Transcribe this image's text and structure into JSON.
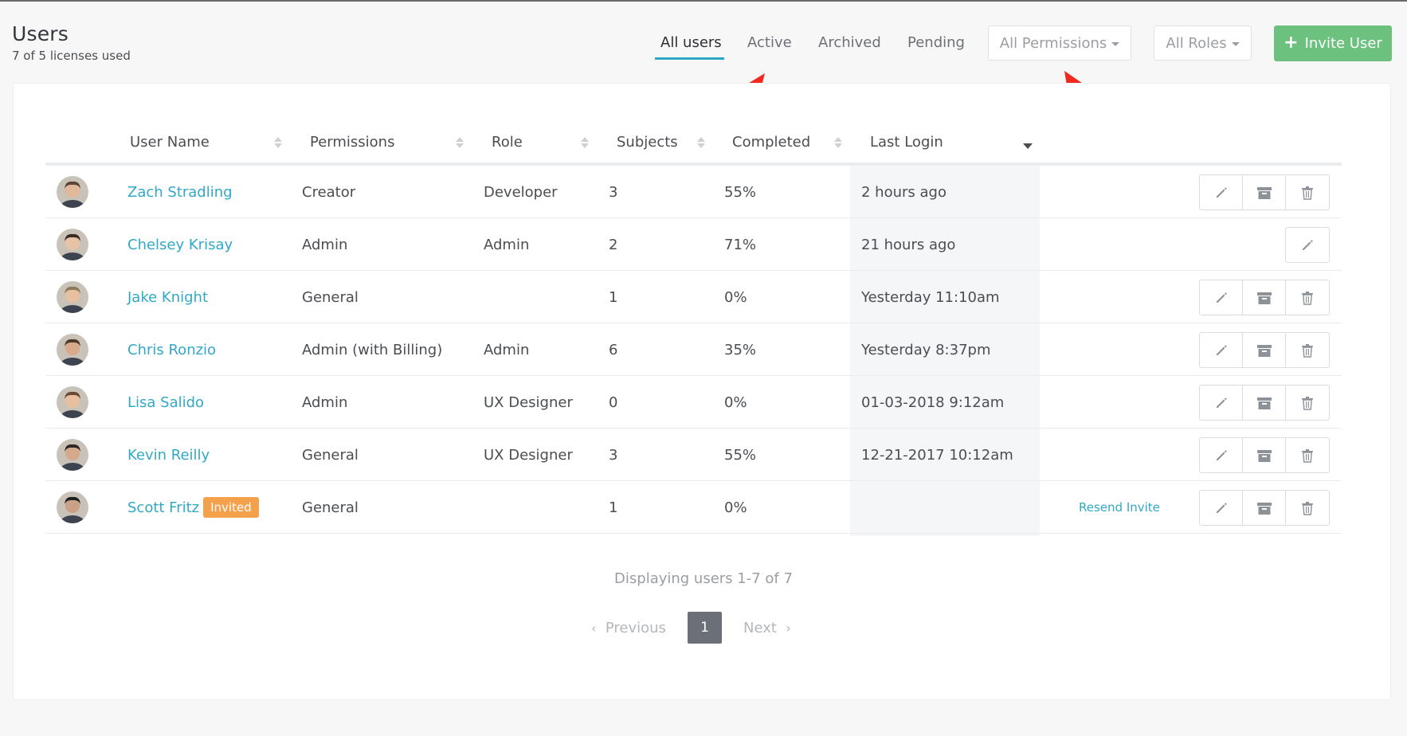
{
  "header": {
    "title": "Users",
    "license_text": "7 of 5 licenses used"
  },
  "tabs": [
    {
      "label": "All users",
      "active": true
    },
    {
      "label": "Active",
      "active": false
    },
    {
      "label": "Archived",
      "active": false
    },
    {
      "label": "Pending",
      "active": false
    }
  ],
  "filters": {
    "permissions": "All Permissions",
    "roles": "All Roles"
  },
  "invite_button": "Invite User",
  "table": {
    "columns": [
      "User Name",
      "Permissions",
      "Role",
      "Subjects",
      "Completed",
      "Last Login"
    ],
    "rows": [
      {
        "name": "Zach Stradling",
        "permissions": "Creator",
        "role": "Developer",
        "subjects": "3",
        "completed": "55%",
        "last_login": "2 hours ago",
        "badge": "",
        "resend": "",
        "actions": [
          "edit",
          "archive",
          "delete"
        ]
      },
      {
        "name": "Chelsey Krisay",
        "permissions": "Admin",
        "role": "Admin",
        "subjects": "2",
        "completed": "71%",
        "last_login": "21 hours ago",
        "badge": "",
        "resend": "",
        "actions": [
          "edit"
        ]
      },
      {
        "name": "Jake Knight",
        "permissions": "General",
        "role": "",
        "subjects": "1",
        "completed": "0%",
        "last_login": "Yesterday 11:10am",
        "badge": "",
        "resend": "",
        "actions": [
          "edit",
          "archive",
          "delete"
        ]
      },
      {
        "name": "Chris Ronzio",
        "permissions": "Admin (with Billing)",
        "role": "Admin",
        "subjects": "6",
        "completed": "35%",
        "last_login": "Yesterday 8:37pm",
        "badge": "",
        "resend": "",
        "actions": [
          "edit",
          "archive",
          "delete"
        ]
      },
      {
        "name": "Lisa Salido",
        "permissions": "Admin",
        "role": "UX Designer",
        "subjects": "0",
        "completed": "0%",
        "last_login": "01-03-2018 9:12am",
        "badge": "",
        "resend": "",
        "actions": [
          "edit",
          "archive",
          "delete"
        ]
      },
      {
        "name": "Kevin Reilly",
        "permissions": "General",
        "role": "UX Designer",
        "subjects": "3",
        "completed": "55%",
        "last_login": "12-21-2017 10:12am",
        "badge": "",
        "resend": "",
        "actions": [
          "edit",
          "archive",
          "delete"
        ]
      },
      {
        "name": "Scott Fritz",
        "permissions": "General",
        "role": "",
        "subjects": "1",
        "completed": "0%",
        "last_login": "",
        "badge": "Invited",
        "resend": "Resend Invite",
        "actions": [
          "edit",
          "archive",
          "delete"
        ]
      }
    ]
  },
  "footer": {
    "displaying": "Displaying users 1-7 of 7",
    "previous": "Previous",
    "page": "1",
    "next": "Next"
  },
  "colors": {
    "accent": "#31a9c6",
    "invite_green": "#6cc17f",
    "badge_orange": "#f5a04b",
    "annotation_arrow": "#f02a1e"
  },
  "icons": [
    "pencil-icon",
    "archive-icon",
    "trash-icon",
    "plus-icon",
    "caret-down-icon",
    "chevron-left-icon",
    "chevron-right-icon",
    "sort-icon"
  ]
}
